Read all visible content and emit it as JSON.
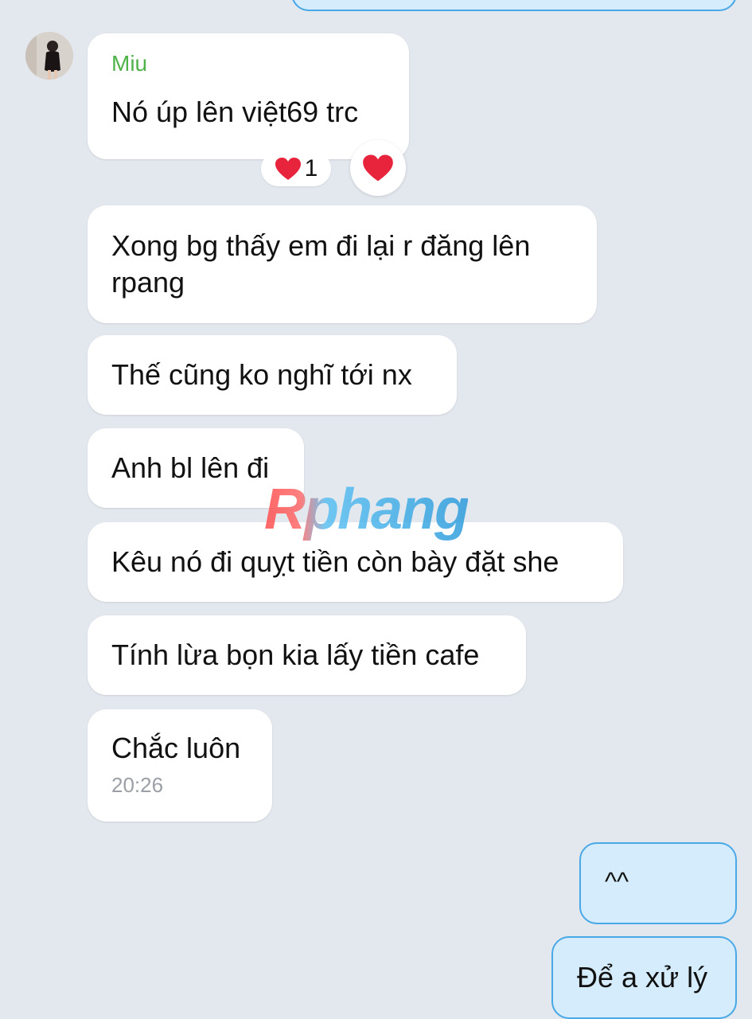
{
  "colors": {
    "background": "#e3e8ee",
    "incoming_bubble": "#ffffff",
    "outgoing_bubble": "#d4ecfb",
    "outgoing_border": "#49a8e6",
    "sender_name": "#4fb34a",
    "time_text": "#9aa0a6",
    "heart": "#e8243d"
  },
  "conversation": {
    "sender_name": "Miu",
    "messages": [
      "Nó úp lên việt69 trc",
      "Xong bg thấy em đi lại r đăng lên rpang",
      "Thế cũng ko nghĩ tới nx",
      "Anh bl lên đi",
      "Kêu nó đi quỵt tiền còn bày đặt she",
      "Tính lừa bọn kia lấy tiền cafe",
      "Chắc luôn"
    ],
    "last_message_time": "20:26",
    "reaction": {
      "icon": "heart-icon",
      "count": "1"
    },
    "outgoing": [
      "^^",
      "Để a xử lý"
    ]
  },
  "watermark": "Rphang"
}
